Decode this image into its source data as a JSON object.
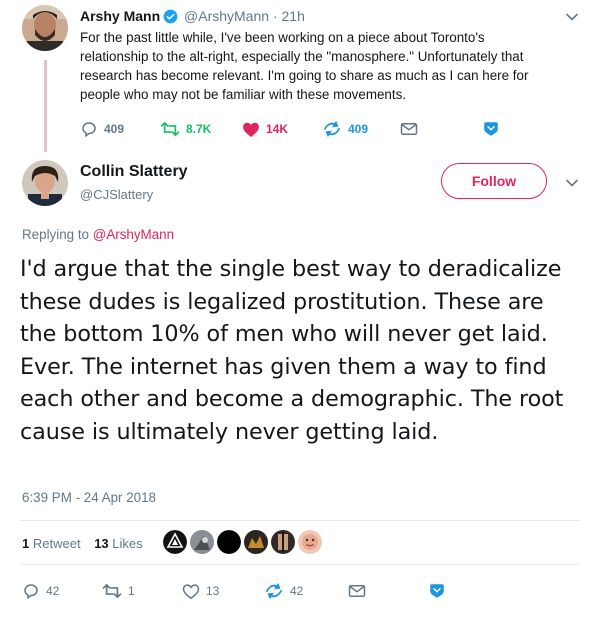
{
  "parent_tweet": {
    "author_name": "Arshy Mann",
    "handle": "@ArshyMann",
    "separator": "·",
    "time": "21h",
    "text": "For the past little while, I've been working on a piece about Toronto's relationship to the alt-right, especially the \"manosphere.\" Unfortunately that research has become relevant. I'm going to share as much as I can here for people who may not be familiar with these movements.",
    "actions": {
      "replies": "409",
      "retweets": "8.7K",
      "likes": "14K",
      "dm": "409"
    }
  },
  "reply_tweet": {
    "author_name": "Collin Slattery",
    "handle": "@CJSlattery",
    "follow_label": "Follow",
    "replying_prefix": "Replying to",
    "replying_handle": "@ArshyMann",
    "text": "I'd argue that the single best way to deradicalize these dudes is legalized prostitution. These are the bottom 10% of men who will never get laid. Ever. The internet has given them a way to find each other and become a demographic. The root cause is ultimately never getting laid.",
    "timestamp": "6:39 PM - 24 Apr 2018",
    "retweet_count": "1",
    "retweet_label": "Retweet",
    "like_count": "13",
    "like_label": "Likes",
    "actions": {
      "replies": "42",
      "retweets": "1",
      "likes": "13",
      "dm": "42"
    }
  },
  "colors": {
    "accent": "#e0245e",
    "retweet_green": "#17bf63",
    "icon_blue": "#1c94e0",
    "secondary_text": "#657786",
    "verified": "#1da1f2"
  },
  "icons": [
    "verified-icon",
    "reply-icon",
    "retweet-icon",
    "heart-icon",
    "dm-icon",
    "mail-icon",
    "bookmark-icon",
    "chevron-down-icon"
  ]
}
